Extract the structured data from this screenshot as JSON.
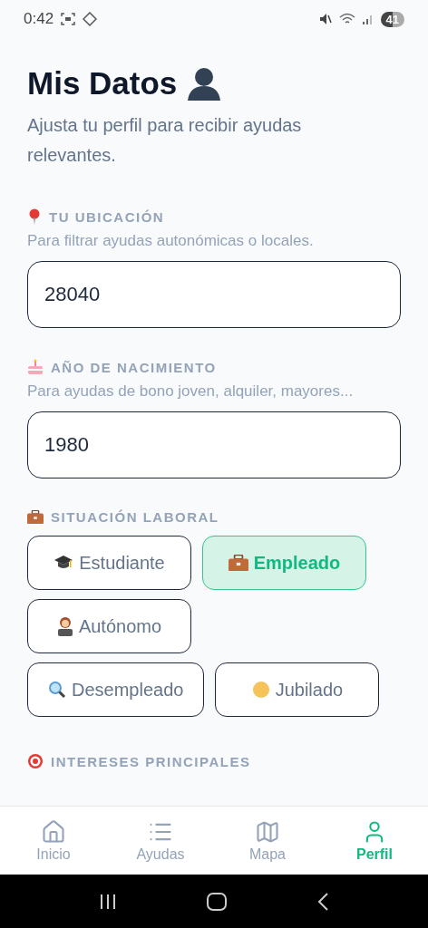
{
  "status_bar": {
    "time": "0:42",
    "battery": "41"
  },
  "header": {
    "title": "Mis Datos",
    "subtitle": "Ajusta tu perfil para recibir ayudas relevantes."
  },
  "location": {
    "label": "TU UBICACIÓN",
    "hint": "Para filtrar ayudas autonómicas o locales.",
    "value": "28040"
  },
  "birth_year": {
    "label": "AÑO DE NACIMIENTO",
    "hint": "Para ayudas de bono joven, alquiler, mayores...",
    "value": "1980"
  },
  "employment": {
    "label": "SITUACIÓN LABORAL",
    "rows": [
      [
        {
          "label": "Estudiante",
          "selected": false
        },
        {
          "label": "Empleado",
          "selected": true
        }
      ],
      [
        {
          "label": "Autónomo",
          "selected": false
        }
      ],
      [
        {
          "label": "Desempleado",
          "selected": false
        },
        {
          "label": "Jubilado",
          "selected": false
        }
      ]
    ]
  },
  "interests": {
    "label": "INTERESES PRINCIPALES"
  },
  "bottom_nav": [
    {
      "label": "Inicio",
      "selected": false
    },
    {
      "label": "Ayudas",
      "selected": false
    },
    {
      "label": "Mapa",
      "selected": false
    },
    {
      "label": "Perfil",
      "selected": true
    }
  ]
}
